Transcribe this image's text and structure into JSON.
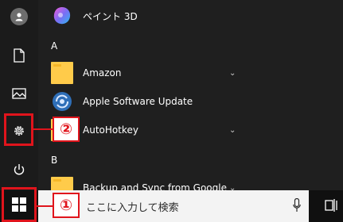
{
  "start_menu": {
    "apps": [
      {
        "label": "ペイント 3D",
        "icon": "paint-3d-icon"
      },
      {
        "label": "Amazon",
        "icon": "folder-icon",
        "expandable": true
      },
      {
        "label": "Apple Software Update",
        "icon": "apple-software-update-icon"
      },
      {
        "label": "AutoHotkey",
        "icon": "folder-icon",
        "expandable": true
      },
      {
        "label": "Backup and Sync from Google",
        "icon": "folder-icon",
        "expandable": true
      }
    ],
    "section_headers": [
      "A",
      "B"
    ]
  },
  "left_rail": {
    "items": [
      {
        "name": "user-account",
        "icon": "user-icon"
      },
      {
        "name": "documents",
        "icon": "document-icon"
      },
      {
        "name": "pictures",
        "icon": "picture-icon"
      },
      {
        "name": "settings",
        "icon": "gear-icon"
      },
      {
        "name": "power",
        "icon": "power-icon"
      }
    ]
  },
  "taskbar": {
    "search_text": "ここに入力して検索",
    "start_icon": "windows-logo-icon",
    "mic_icon": "microphone-icon",
    "taskview_icon": "task-view-icon"
  },
  "annotations": {
    "callout_1": "①",
    "callout_2": "②",
    "highlight_color": "#e0141c"
  }
}
